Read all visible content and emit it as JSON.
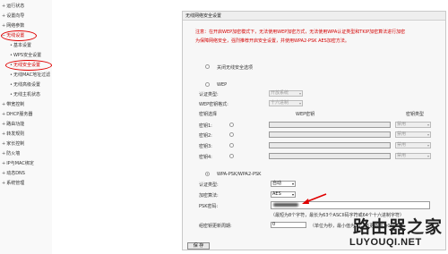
{
  "sidebar": {
    "items": [
      {
        "label": "运行状态",
        "sub": false
      },
      {
        "label": "设置向导",
        "sub": false
      },
      {
        "label": "网络参数",
        "sub": false
      },
      {
        "label": "无线设置",
        "sub": false
      },
      {
        "label": "基本设置",
        "sub": true
      },
      {
        "label": "WPS安全设置",
        "sub": true
      },
      {
        "label": "无线安全设置",
        "sub": true
      },
      {
        "label": "无线MAC地址过滤",
        "sub": true
      },
      {
        "label": "无线高级设置",
        "sub": true
      },
      {
        "label": "无线主机状态",
        "sub": true
      },
      {
        "label": "带宽控制",
        "sub": false
      },
      {
        "label": "DHCP服务器",
        "sub": false
      },
      {
        "label": "路由功能",
        "sub": false
      },
      {
        "label": "转发规则",
        "sub": false
      },
      {
        "label": "家长控制",
        "sub": false
      },
      {
        "label": "防火墙",
        "sub": false
      },
      {
        "label": "IP与MAC绑定",
        "sub": false
      },
      {
        "label": "动态DNS",
        "sub": false
      },
      {
        "label": "系统管理",
        "sub": false
      }
    ]
  },
  "panel": {
    "title": "无线网络安全设置",
    "notice_line1": "注意：在开启WEP加密模式下，无法使用WEP加密方式，无法使用WPA认证类型和TKIP加密算法进行加密",
    "notice_line2": "为保障网络安全，强烈推荐开启安全设置，并使用WPA2-PSK AES加密方法。",
    "disable_label": "关闭无线安全选项",
    "wep": {
      "label": "WEP",
      "auth_type_label": "认证类型:",
      "auth_type_value": "开放系统",
      "key_format_label": "WEP密钥格式:",
      "key_format_value": "十六进制",
      "key_select_label": "密钥选择",
      "key_header": "WEP密钥",
      "key_type_header": "密钥类型",
      "keys": [
        {
          "label": "密钥1:",
          "type": "禁用"
        },
        {
          "label": "密钥2:",
          "type": "禁用"
        },
        {
          "label": "密钥3:",
          "type": "禁用"
        },
        {
          "label": "密钥4:",
          "type": "禁用"
        }
      ]
    },
    "wpa": {
      "label": "WPA-PSK/WPA2-PSK",
      "auth_type_label": "认证类型:",
      "auth_type_value": "自动",
      "encryption_label": "加密算法:",
      "encryption_value": "AES",
      "psk_label": "PSK密码:",
      "psk_hint": "（最短为8个字符，最长为63个ASCII码字符或64个十六进制字符）",
      "interval_label": "组密钥更新周期:",
      "interval_value": "0",
      "interval_hint": "（单位为秒，最小值为30，不更新则为0）"
    },
    "save_label": "保 存"
  },
  "watermark": {
    "cn": "路由器之家",
    "en": "LUYOUQI.NET"
  },
  "colors": {
    "notice": "#d40000",
    "highlight": "#e00000"
  }
}
